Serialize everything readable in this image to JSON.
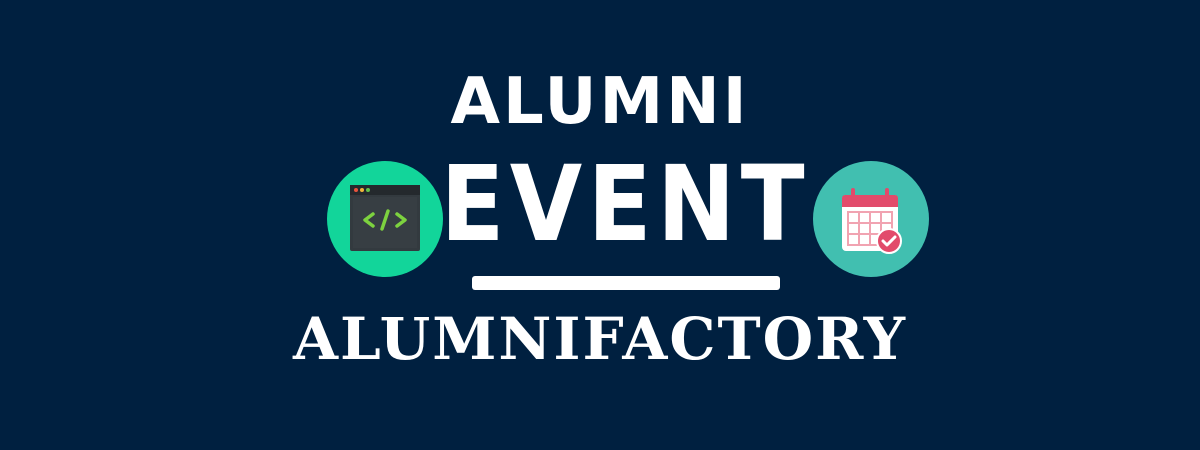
{
  "banner": {
    "title_top": "ALUMNI",
    "title_main": "EVENT",
    "brand": "ALUMNIFACTORY"
  },
  "icons": {
    "left": {
      "name": "code-window-icon",
      "circle_color": "#12d59a"
    },
    "right": {
      "name": "calendar-check-icon",
      "circle_color": "#41bfb0"
    }
  },
  "colors": {
    "background": "#002040",
    "text": "#ffffff"
  }
}
